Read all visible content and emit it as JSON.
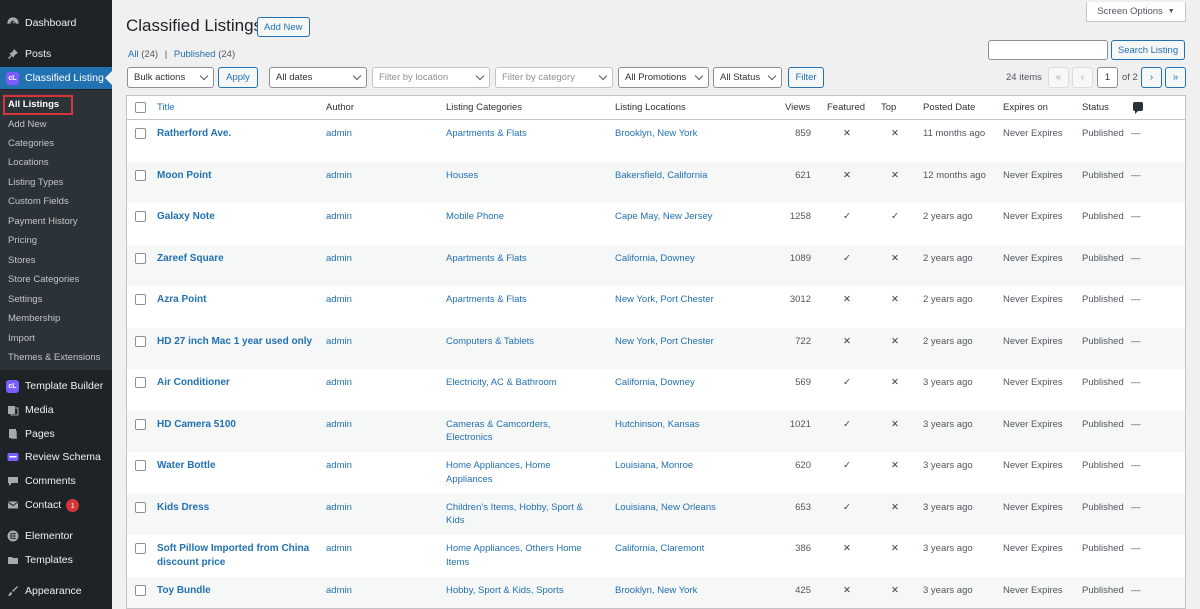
{
  "sidebar": {
    "top_items": [
      {
        "label": "Dashboard",
        "icon": "dashboard-icon"
      },
      {
        "label": "Posts",
        "icon": "pin-icon"
      },
      {
        "label": "Classified Listing",
        "icon": "classified-listing-logo-icon"
      }
    ],
    "submenu": [
      {
        "label": "All Listings"
      },
      {
        "label": "Add New"
      },
      {
        "label": "Categories"
      },
      {
        "label": "Locations"
      },
      {
        "label": "Listing Types"
      },
      {
        "label": "Custom Fields"
      },
      {
        "label": "Payment History"
      },
      {
        "label": "Pricing"
      },
      {
        "label": "Stores"
      },
      {
        "label": "Store Categories"
      },
      {
        "label": "Settings"
      },
      {
        "label": "Membership"
      },
      {
        "label": "Import"
      },
      {
        "label": "Themes & Extensions"
      }
    ],
    "bottom_items": [
      {
        "label": "Template Builder",
        "icon": "template-builder-logo-icon"
      },
      {
        "label": "Media",
        "icon": "media-icon"
      },
      {
        "label": "Pages",
        "icon": "pages-icon"
      },
      {
        "label": "Review Schema",
        "icon": "review-schema-icon"
      },
      {
        "label": "Comments",
        "icon": "comments-icon"
      },
      {
        "label": "Contact",
        "icon": "mail-icon",
        "badge": "1"
      },
      {
        "label": "Elementor",
        "icon": "elementor-icon"
      },
      {
        "label": "Templates",
        "icon": "folder-icon"
      },
      {
        "label": "Appearance",
        "icon": "brush-icon"
      }
    ]
  },
  "header": {
    "title": "Classified Listings",
    "add_new": "Add New",
    "screen_options": "Screen Options",
    "views": {
      "all": "All",
      "all_count": "(24)",
      "sep": "|",
      "published": "Published",
      "published_count": "(24)"
    },
    "search_button": "Search Listing"
  },
  "filters": {
    "bulk_actions": "Bulk actions",
    "apply": "Apply",
    "dates": "All dates",
    "location_placeholder": "Filter by location",
    "category_placeholder": "Filter by category",
    "promotions": "All Promotions",
    "status": "All Status",
    "filter_button": "Filter"
  },
  "pagination": {
    "items": "24 items",
    "first": "«",
    "prev": "‹",
    "current": "1",
    "of": "of 2",
    "next": "›",
    "last": "»"
  },
  "table": {
    "columns": {
      "title": "Title",
      "author": "Author",
      "categories": "Listing Categories",
      "locations": "Listing Locations",
      "views": "Views",
      "featured": "Featured",
      "top": "Top",
      "posted": "Posted Date",
      "expires": "Expires on",
      "status": "Status"
    },
    "rows": [
      {
        "title": "Ratherford Ave.",
        "author": "admin",
        "categories": "Apartments & Flats",
        "locations": "Brooklyn, New York",
        "views": "859",
        "featured": "✕",
        "top": "✕",
        "posted": "11 months ago",
        "expires": "Never Expires",
        "status": "Published",
        "comments": "—"
      },
      {
        "title": "Moon Point",
        "author": "admin",
        "categories": "Houses",
        "locations": "Bakersfield, California",
        "views": "621",
        "featured": "✕",
        "top": "✕",
        "posted": "12 months ago",
        "expires": "Never Expires",
        "status": "Published",
        "comments": "—"
      },
      {
        "title": "Galaxy Note",
        "author": "admin",
        "categories": "Mobile Phone",
        "locations": "Cape May, New Jersey",
        "views": "1258",
        "featured": "✓",
        "top": "✓",
        "posted": "2 years ago",
        "expires": "Never Expires",
        "status": "Published",
        "comments": "—"
      },
      {
        "title": "Zareef Square",
        "author": "admin",
        "categories": "Apartments & Flats",
        "locations": "California, Downey",
        "views": "1089",
        "featured": "✓",
        "top": "✕",
        "posted": "2 years ago",
        "expires": "Never Expires",
        "status": "Published",
        "comments": "—"
      },
      {
        "title": "Azra Point",
        "author": "admin",
        "categories": "Apartments & Flats",
        "locations": "New York, Port Chester",
        "views": "3012",
        "featured": "✕",
        "top": "✕",
        "posted": "2 years ago",
        "expires": "Never Expires",
        "status": "Published",
        "comments": "—"
      },
      {
        "title": "HD 27 inch Mac 1 year used only",
        "author": "admin",
        "categories": "Computers & Tablets",
        "locations": "New York, Port Chester",
        "views": "722",
        "featured": "✕",
        "top": "✕",
        "posted": "2 years ago",
        "expires": "Never Expires",
        "status": "Published",
        "comments": "—"
      },
      {
        "title": "Air Conditioner",
        "author": "admin",
        "categories": "Electricity, AC & Bathroom",
        "locations": "California, Downey",
        "views": "569",
        "featured": "✓",
        "top": "✕",
        "posted": "3 years ago",
        "expires": "Never Expires",
        "status": "Published",
        "comments": "—"
      },
      {
        "title": "HD Camera 5100",
        "author": "admin",
        "categories": "Cameras & Camcorders, Electronics",
        "locations": "Hutchinson, Kansas",
        "views": "1021",
        "featured": "✓",
        "top": "✕",
        "posted": "3 years ago",
        "expires": "Never Expires",
        "status": "Published",
        "comments": "—"
      },
      {
        "title": "Water Bottle",
        "author": "admin",
        "categories": "Home Appliances, Home Appliances",
        "locations": "Louisiana, Monroe",
        "views": "620",
        "featured": "✓",
        "top": "✕",
        "posted": "3 years ago",
        "expires": "Never Expires",
        "status": "Published",
        "comments": "—"
      },
      {
        "title": "Kids Dress",
        "author": "admin",
        "categories": "Children's Items, Hobby, Sport & Kids",
        "locations": "Louisiana, New Orleans",
        "views": "653",
        "featured": "✓",
        "top": "✕",
        "posted": "3 years ago",
        "expires": "Never Expires",
        "status": "Published",
        "comments": "—"
      },
      {
        "title": "Soft Pillow Imported from China discount price",
        "author": "admin",
        "categories": "Home Appliances, Others Home Items",
        "locations": "California, Claremont",
        "views": "386",
        "featured": "✕",
        "top": "✕",
        "posted": "3 years ago",
        "expires": "Never Expires",
        "status": "Published",
        "comments": "—"
      },
      {
        "title": "Toy Bundle",
        "author": "admin",
        "categories": "Hobby, Sport & Kids, Sports",
        "locations": "Brooklyn, New York",
        "views": "425",
        "featured": "✕",
        "top": "✕",
        "posted": "3 years ago",
        "expires": "Never Expires",
        "status": "Published",
        "comments": "—"
      }
    ]
  },
  "colors": {
    "sidebar_bg": "#1d2327",
    "accent": "#2271b1",
    "highlight": "#d63638"
  }
}
